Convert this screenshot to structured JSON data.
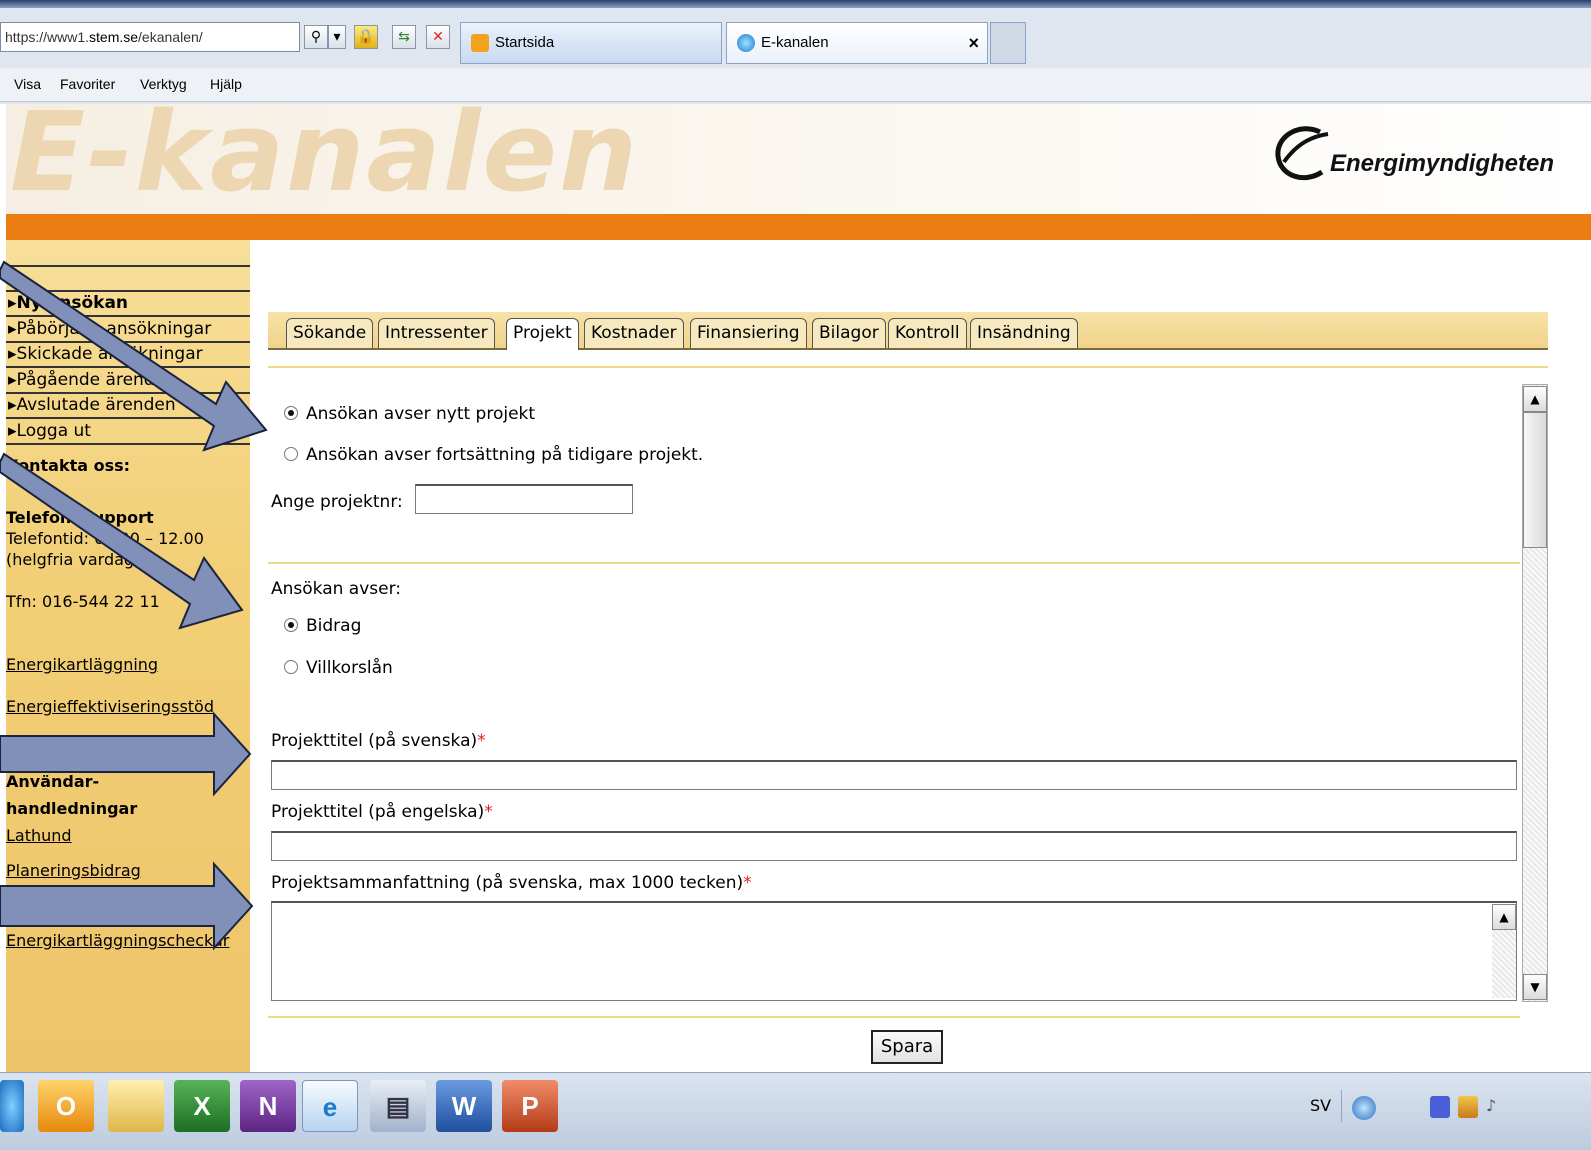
{
  "browser": {
    "url_prefix": "https://www1.",
    "url_host": "stem.se",
    "url_path": "/ekanalen/",
    "tabs": [
      {
        "label": "Startsida"
      },
      {
        "label": "E-kanalen"
      }
    ],
    "close_glyph": "×",
    "menu": [
      "Visa",
      "Favoriter",
      "Verktyg",
      "Hjälp"
    ]
  },
  "banner": {
    "title": "E-kanalen",
    "logo_text": "Energimyndigheten"
  },
  "sidebar": {
    "nav": [
      "",
      "",
      "▸Ny ansökan",
      "▸Påbörjade ansökningar",
      "▸Skickade ansökningar",
      "▸Pågående ärenden",
      "▸Avslutade ärenden",
      "▸Logga ut"
    ],
    "contact_heading": "Kontakta oss:",
    "phone_heading": "Telefon: support",
    "phone_hours": "Telefontid: 09.00 – 12.00",
    "phone_days": "(helgfria vardagar)",
    "phone_number": "Tfn: 016-544 22 11",
    "links": [
      "Energikartläggning",
      "Energieffektiviseringsstöd"
    ],
    "guides_heading_1": "Användar-",
    "guides_heading_2": "handledningar",
    "guide_links": [
      "Lathund",
      "Planeringsbidrag",
      "Energikartläggningscheckar"
    ]
  },
  "form": {
    "tabs": [
      "Sökande",
      "Intressenter",
      "Projekt",
      "Kostnader",
      "Finansiering",
      "Bilagor",
      "Kontroll",
      "Insändning"
    ],
    "active_tab": "Projekt",
    "project_type_options": [
      "Ansökan avser nytt projekt",
      "Ansökan avser fortsättning på tidigare projekt."
    ],
    "project_type_selected": 0,
    "project_number_label": "Ange projektnr:",
    "project_number_value": "",
    "application_type_label": "Ansökan avser:",
    "application_type_options": [
      "Bidrag",
      "Villkorslån"
    ],
    "application_type_selected": 0,
    "title_sv_label": "Projekttitel (på svenska)",
    "title_en_label": "Projekttitel (på engelska)",
    "summary_label": "Projektsammanfattning (på svenska, max 1000 tecken)",
    "required_mark": "*",
    "title_sv_value": "",
    "title_en_value": "",
    "summary_value": "",
    "save_label": "Spara"
  },
  "taskbar": {
    "language": "SV"
  },
  "colors": {
    "orange_bar": "#ea7d12",
    "sidebar_bg": "#f2cf76",
    "tab_bg": "#f6e9bf",
    "required": "#e02020",
    "annotation_arrow": "#8090b8"
  }
}
